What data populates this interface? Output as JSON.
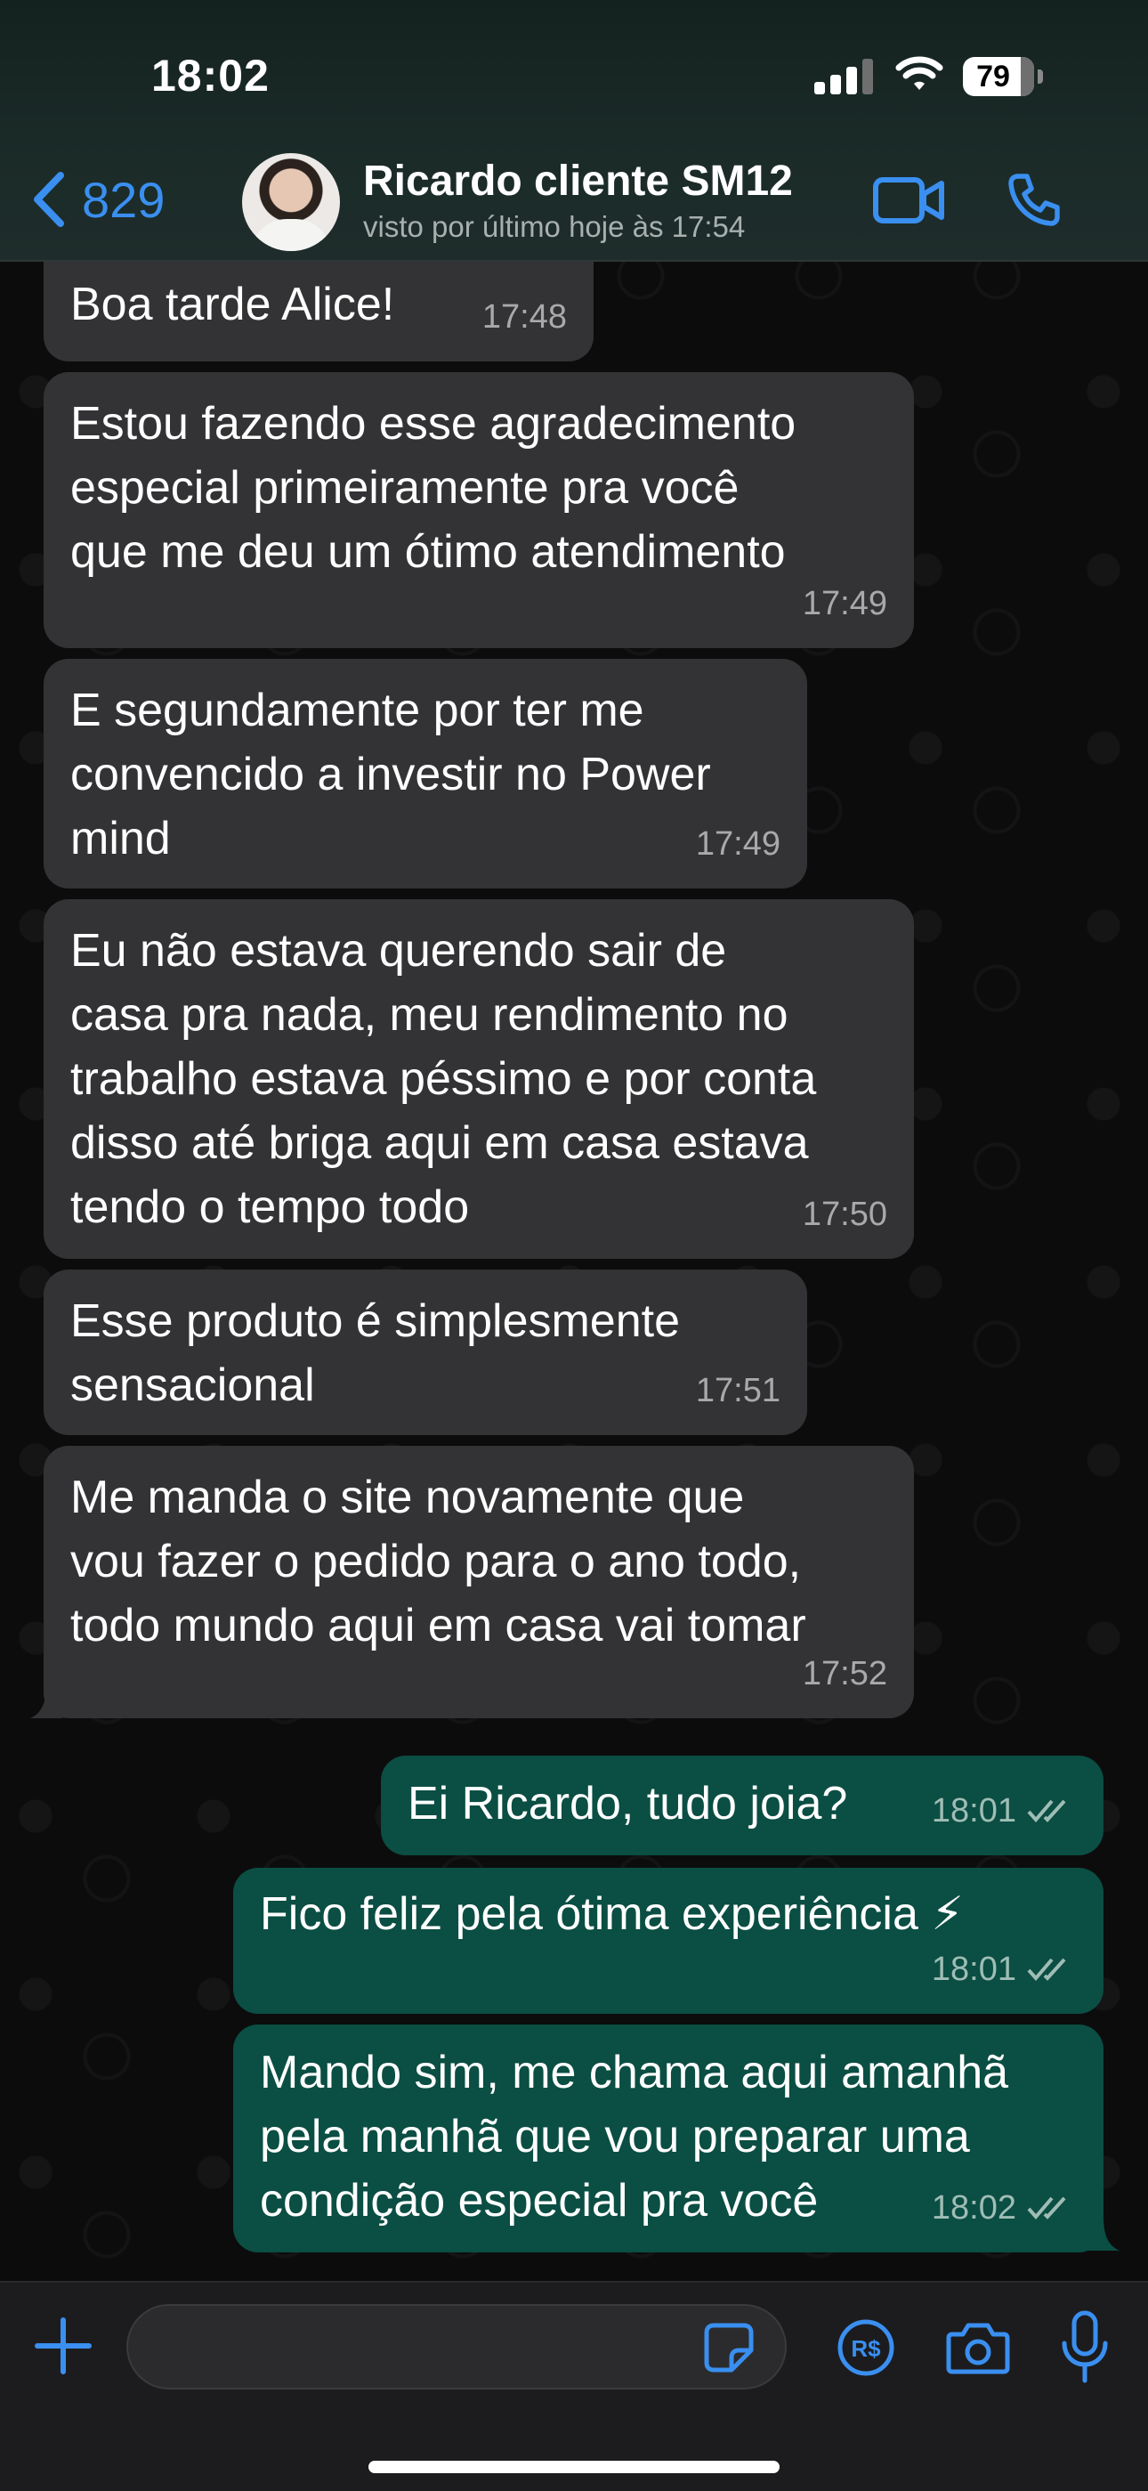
{
  "status_bar": {
    "time": "18:02",
    "battery": "79"
  },
  "header": {
    "back_count": "829",
    "contact_name": "Ricardo cliente SM12",
    "contact_status": "visto por último hoje às 17:54"
  },
  "messages": [
    {
      "dir": "in",
      "text": "Boa tarde Alice!",
      "time": "17:48"
    },
    {
      "dir": "in",
      "text": "Estou fazendo esse agradecimento\nespecial primeiramente pra você\nque me deu um ótimo atendimento",
      "time": "17:49"
    },
    {
      "dir": "in",
      "text": "E segundamente por ter me\nconvencido a investir no Power\nmind",
      "time": "17:49"
    },
    {
      "dir": "in",
      "text": "Eu não estava querendo sair de\ncasa pra nada, meu rendimento no\ntrabalho estava péssimo e por conta\ndisso até briga aqui em casa estava\ntendo o tempo todo",
      "time": "17:50"
    },
    {
      "dir": "in",
      "text": "Esse produto é simplesmente\nsensacional",
      "time": "17:51"
    },
    {
      "dir": "in",
      "text": "Me manda o site novamente que\nvou fazer o pedido para o ano todo,\ntodo mundo aqui em casa vai tomar",
      "time": "17:52"
    },
    {
      "dir": "out",
      "text": "Ei Ricardo, tudo joia?",
      "time": "18:01"
    },
    {
      "dir": "out",
      "text": "Fico feliz pela ótima experiência ⚡",
      "time": "18:01"
    },
    {
      "dir": "out",
      "text": "Mando sim, me chama aqui amanhã\npela manhã que vou preparar uma\ncondição especial pra você",
      "time": "18:02"
    }
  ],
  "input": {
    "value": "",
    "placeholder": ""
  },
  "icons": {
    "back": "chevron-left-icon",
    "video": "video-camera-icon",
    "call": "phone-icon",
    "plus": "plus-icon",
    "sticker": "sticker-icon",
    "payment": "pix-payment-icon",
    "camera": "camera-icon",
    "mic": "microphone-icon"
  },
  "colors": {
    "accent": "#3a8ff0",
    "incoming_bubble": "#333335",
    "outgoing_bubble": "#0b4e43"
  }
}
